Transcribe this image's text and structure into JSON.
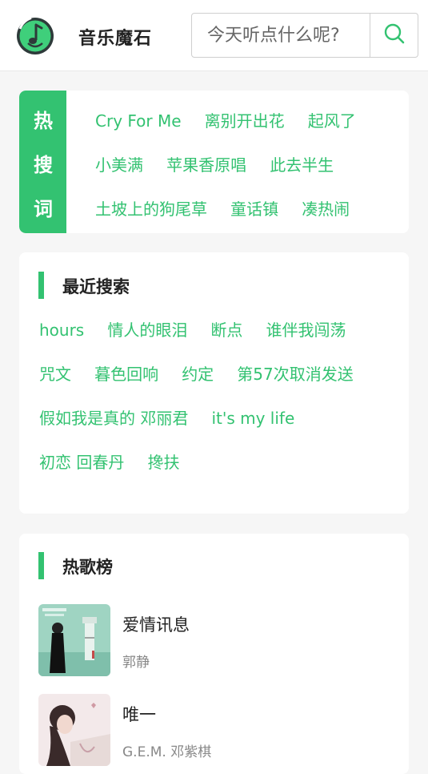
{
  "header": {
    "brand": "音乐魔石",
    "search_placeholder": "今天听点什么呢?"
  },
  "hot_search": {
    "label_chars": [
      "热",
      "搜",
      "词"
    ],
    "rows": [
      [
        "Cry For Me",
        "离别开出花",
        "起风了"
      ],
      [
        "小美满",
        "苹果香原唱",
        "此去半生"
      ],
      [
        "土坡上的狗尾草",
        "童话镇",
        "凑热闹"
      ]
    ]
  },
  "recent_search": {
    "title": "最近搜索",
    "rows": [
      [
        "hours",
        "情人的眼泪",
        "断点",
        "谁伴我闯荡"
      ],
      [
        "咒文",
        "暮色回响",
        "约定",
        "第57次取消发送"
      ],
      [
        "假如我是真的 邓丽君",
        "it's my life"
      ],
      [
        "初恋 回春丹",
        "搀扶"
      ]
    ]
  },
  "hot_songs": {
    "title": "热歌榜",
    "items": [
      {
        "title": "爱情讯息",
        "artist": "郭静"
      },
      {
        "title": "唯一",
        "artist": "G.E.M. 邓紫棋"
      }
    ]
  },
  "colors": {
    "accent": "#33c271",
    "background": "#f6f6f6"
  },
  "icons": {
    "logo": "music-note-logo-icon",
    "search": "search-icon"
  }
}
